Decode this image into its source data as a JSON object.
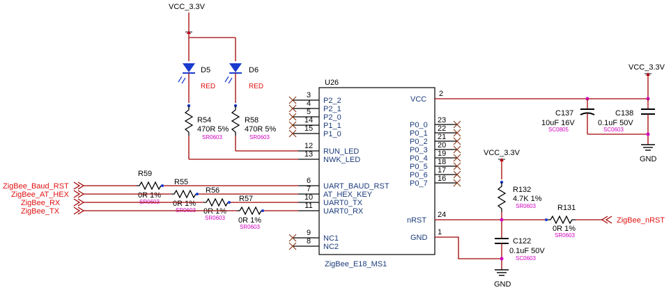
{
  "rails": [
    {
      "label": "VCC_3.3V"
    },
    {
      "label": "VCC_3.3V"
    },
    {
      "label": "VCC_3.3V"
    }
  ],
  "grounds": [
    {
      "label": "GND"
    },
    {
      "label": "GND"
    }
  ],
  "chip": {
    "ref": "U26",
    "part": "ZigBee_E18_MS1",
    "left_pins": [
      {
        "num": "3",
        "name": "P2_2"
      },
      {
        "num": "4",
        "name": "P2_1"
      },
      {
        "num": "5",
        "name": "P2_0"
      },
      {
        "num": "14",
        "name": "P1_1"
      },
      {
        "num": "15",
        "name": "P1_0"
      },
      {
        "num": "12",
        "name": "RUN_LED"
      },
      {
        "num": "13",
        "name": "NWK_LED"
      },
      {
        "num": "6",
        "name": "UART_BAUD_RST"
      },
      {
        "num": "7",
        "name": "AT_HEX_KEY"
      },
      {
        "num": "10",
        "name": "UART0_TX"
      },
      {
        "num": "11",
        "name": "UART0_RX"
      },
      {
        "num": "9",
        "name": "NC1"
      },
      {
        "num": "8",
        "name": "NC2"
      }
    ],
    "right_pins": [
      {
        "num": "2",
        "name": "VCC"
      },
      {
        "num": "23",
        "name": "P0_0"
      },
      {
        "num": "22",
        "name": "P0_1"
      },
      {
        "num": "21",
        "name": "P0_2"
      },
      {
        "num": "20",
        "name": "P0_3"
      },
      {
        "num": "19",
        "name": "P0_4"
      },
      {
        "num": "18",
        "name": "P0_5"
      },
      {
        "num": "17",
        "name": "P0_6"
      },
      {
        "num": "16",
        "name": "P0_7"
      },
      {
        "num": "24",
        "name": "nRST"
      },
      {
        "num": "1",
        "name": "GND"
      }
    ]
  },
  "leds": [
    {
      "ref": "D5",
      "color": "RED"
    },
    {
      "ref": "D6",
      "color": "RED"
    }
  ],
  "resistors": [
    {
      "ref": "R54",
      "value": "470R 5%",
      "package": "SR0603"
    },
    {
      "ref": "R58",
      "value": "470R 5%",
      "package": "SR0603"
    },
    {
      "ref": "R59",
      "value": "0R 1%",
      "package": "SR0603"
    },
    {
      "ref": "R55",
      "value": "0R 1%",
      "package": "SR0603"
    },
    {
      "ref": "R56",
      "value": "0R 1%",
      "package": "SR0603"
    },
    {
      "ref": "R57",
      "value": "0R 1%",
      "package": "SR0603"
    },
    {
      "ref": "R132",
      "value": "4.7K 1%",
      "package": "SR0603"
    },
    {
      "ref": "R131",
      "value": "0R 1%",
      "package": "SR0603"
    }
  ],
  "capacitors": [
    {
      "ref": "C137",
      "value": "10uF 16V",
      "package": "SC0805"
    },
    {
      "ref": "C138",
      "value": "0.1uF 50V",
      "package": "SC0603"
    },
    {
      "ref": "C122",
      "value": "0.1uF 50V",
      "package": "SC0603"
    }
  ],
  "nets": [
    {
      "label": "ZigBee_Baud_RST"
    },
    {
      "label": "ZigBee_AT_HEX"
    },
    {
      "label": "ZigBee_RX"
    },
    {
      "label": "ZigBee_TX"
    },
    {
      "label": "ZigBee_nRST"
    }
  ],
  "colors": {
    "wire": "#a00000",
    "net_label": "#e01010",
    "package_label": "#d000c0",
    "pin_name": "#1a3a7a"
  }
}
